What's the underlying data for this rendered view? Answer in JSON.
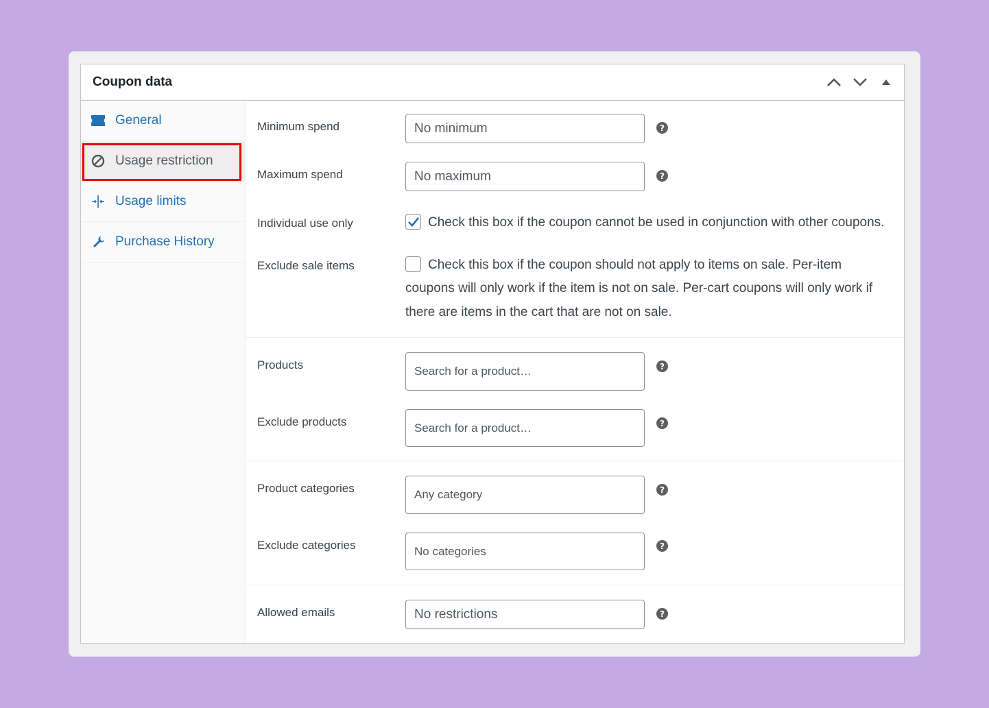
{
  "panel": {
    "title": "Coupon data",
    "controls": [
      "chevron-up-icon",
      "chevron-down-icon",
      "triangle-up-icon"
    ]
  },
  "tabs": [
    {
      "label": "General",
      "icon": "ticket-icon"
    },
    {
      "label": "Usage restriction",
      "icon": "ban-icon",
      "active": true
    },
    {
      "label": "Usage limits",
      "icon": "limits-icon"
    },
    {
      "label": "Purchase History",
      "icon": "wrench-icon"
    }
  ],
  "fields": {
    "minimum_spend": {
      "label": "Minimum spend",
      "placeholder": "No minimum"
    },
    "maximum_spend": {
      "label": "Maximum spend",
      "placeholder": "No maximum"
    },
    "individual_use": {
      "label": "Individual use only",
      "checked": true,
      "description": "Check this box if the coupon cannot be used in conjunction with other coupons."
    },
    "exclude_sale": {
      "label": "Exclude sale items",
      "checked": false,
      "description_line1": "Check this box if the coupon should not apply to items on sale. Per-item",
      "description_line2": "coupons will only work if the item is not on sale. Per-cart coupons will only work if",
      "description_line3": "there are items in the cart that are not on sale."
    },
    "products": {
      "label": "Products",
      "placeholder": "Search for a product…"
    },
    "exclude_products": {
      "label": "Exclude products",
      "placeholder": "Search for a product…"
    },
    "product_categories": {
      "label": "Product categories",
      "placeholder": "Any category"
    },
    "exclude_categories": {
      "label": "Exclude categories",
      "placeholder": "No categories"
    },
    "allowed_emails": {
      "label": "Allowed emails",
      "placeholder": "No restrictions"
    }
  },
  "help_symbol": "?",
  "colors": {
    "background": "#c3aae2",
    "link": "#2271b1",
    "highlight": "#e60000",
    "checkbox_accent": "#2271b1"
  }
}
